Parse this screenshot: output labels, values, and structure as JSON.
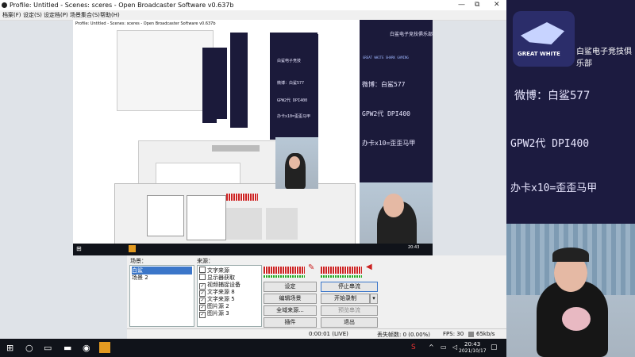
{
  "window": {
    "title": "Profile: Untitled - Scenes: sceres - Open Broadcaster Software v0.637b",
    "controls": [
      "—",
      "⧉",
      "✕"
    ]
  },
  "menu": [
    "档案(F)",
    "设定(S)",
    "设定档(P)",
    "场景集合(S)",
    "帮助(H)"
  ],
  "nested": {
    "title": "Profile: Untitled - Scenes: sceres - Open Broadcaster Software v0.637b"
  },
  "stream_panel": {
    "brand": "白鲨电子竞技俱乐部",
    "logo": "GREAT WHITE SHARK GAMING",
    "lines": [
      "微博：白鲨577",
      "GPW2代 DPI400",
      "办卡x10=歪歪马甲"
    ]
  },
  "scenes_label": "场景：",
  "sources_label": "来源：",
  "scenes": [
    {
      "label": "白鲨",
      "selected": true
    },
    {
      "label": "场景 2",
      "selected": false
    }
  ],
  "sources": [
    {
      "label": "文字来源",
      "checked": false
    },
    {
      "label": "显示器获取",
      "checked": false
    },
    {
      "label": "视频捕捉设备",
      "checked": true
    },
    {
      "label": "文字来源 8",
      "checked": true
    },
    {
      "label": "文字来源 5",
      "checked": true
    },
    {
      "label": "图片源 2",
      "checked": true
    },
    {
      "label": "图片源 3",
      "checked": true
    }
  ],
  "buttons": {
    "settings": "设定",
    "stop_stream": "停止串流",
    "edit_scene": "编辑场景",
    "start_record": "开始录制",
    "global_sources": "全域来源...",
    "preview_stream": "预览串流",
    "plugins": "插件",
    "exit": "退出"
  },
  "status": {
    "time": "0:00:01 (LIVE)",
    "dropped": "丢失帧数: 0 (0.00%)",
    "fps": "FPS: 30",
    "bitrate": "65kb/s"
  },
  "taskbar": {
    "time": "20:43",
    "date": "2021/10/17"
  },
  "right_panel": {
    "brand": "白鲨电子竞技俱乐部",
    "logo": "GREAT WHITE SHARK GAMING",
    "lines": [
      "微博：白鲨577",
      "GPW2代 DPI400",
      "办卡x10=歪歪马甲"
    ]
  },
  "colors": {
    "accent": "#3b76c9",
    "panel": "#1c1b40",
    "meter": "#cc2222",
    "taskbar": "#10131a"
  }
}
